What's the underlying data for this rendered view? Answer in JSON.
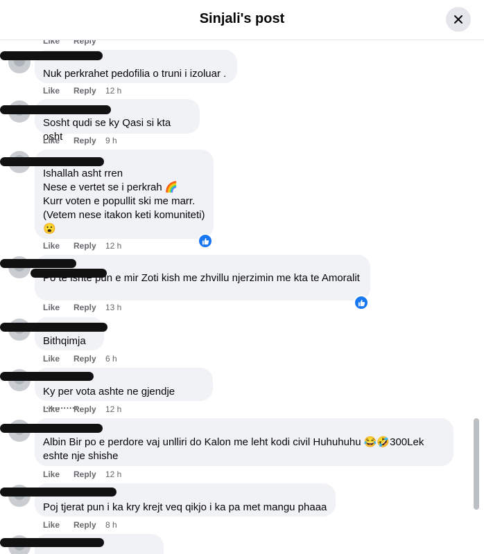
{
  "header": {
    "title": "Sinjali's post"
  },
  "actions": {
    "like": "Like",
    "reply": "Reply"
  },
  "comments": [
    {
      "author": "",
      "text": "Nuk perkrahet pedofilia o truni i izoluar .",
      "time": "12 h"
    },
    {
      "author": "",
      "text": "Sosht qudi se ky Qasi si kta osht",
      "time": "9 h"
    },
    {
      "author": "",
      "text": "Ishallah asht rren\nNese e vertet se i perkrah 🌈\nKurr voten e popullit ski me marr.\n(Vetem nese itakon keti komuniteti)\n😮",
      "time": "12 h",
      "reaction": "like"
    },
    {
      "author": "",
      "text": "Po të ishte pun e mir Zoti kish me zhvillu njerzimin me kta te Amoralit",
      "time": "13 h",
      "reaction": "like"
    },
    {
      "author": "",
      "text": "Bithqimja",
      "time": "6 h"
    },
    {
      "author": "",
      "text": "Ky per vota ashte ne gjendje ............",
      "time": "12 h"
    },
    {
      "author": "",
      "text": "Albin Bir po e perdore vaj unlliri do Kalon me leht kodi civil Huhuhuhu 😂🤣300Lek\neshte nje shishe",
      "time": "12 h"
    },
    {
      "author": "",
      "text": "Poj tjerat pun i ka kry krejt veq qikjo i ka pa met mangu phaaa",
      "time": "8 h"
    },
    {
      "author": "",
      "text": "",
      "time": ""
    }
  ],
  "icons": {
    "close": "close-icon",
    "reaction": "thumbs-up-icon"
  },
  "colors": {
    "bubble": "#f0f2f5",
    "meta": "#65676b",
    "accent": "#1877f2"
  }
}
